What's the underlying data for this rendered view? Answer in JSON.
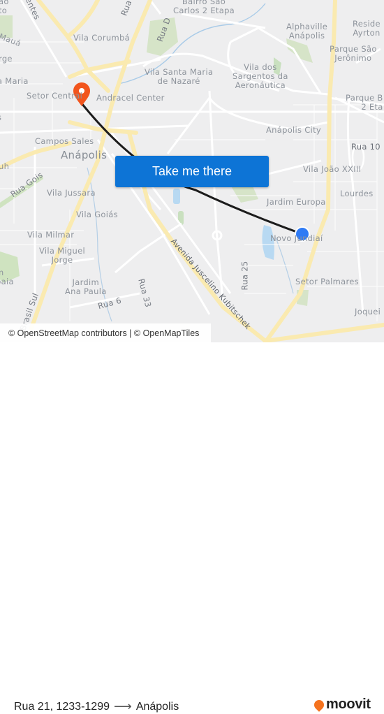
{
  "map": {
    "labels": [
      {
        "text": "Bairro São\nCarlos 2 Etapa",
        "name": "label-bairro-sao-carlos"
      },
      {
        "text": "Alphaville\nAnápolis",
        "name": "label-alphaville"
      },
      {
        "text": "Reside\nAyrton",
        "name": "label-residencial-ayrton"
      },
      {
        "text": "Parque São\nJerônimo",
        "name": "label-parque-sao-jeronimo"
      },
      {
        "text": "Vila Corumbá",
        "name": "label-vila-corumba"
      },
      {
        "text": "Vila Santa Maria\nde Nazaré",
        "name": "label-vila-santa-maria-nazare"
      },
      {
        "text": "Vila dos\nSargentos da\nAeronáutica",
        "name": "label-vila-sargentos"
      },
      {
        "text": "Setor Central",
        "name": "label-setor-central"
      },
      {
        "text": "Andracel Center",
        "name": "label-andracel-center"
      },
      {
        "text": "Parque B\n2 Eta",
        "name": "label-parque-b"
      },
      {
        "text": "Anápolis City",
        "name": "label-anapolis-city"
      },
      {
        "text": "Campos Sales",
        "name": "label-campos-sales"
      },
      {
        "text": "Anápolis",
        "name": "label-anapolis"
      },
      {
        "text": "Rua 10",
        "name": "label-rua-10"
      },
      {
        "text": "Vila João XXIII",
        "name": "label-vila-joao-xxiii"
      },
      {
        "text": "Lourdes",
        "name": "label-lourdes"
      },
      {
        "text": "Jardim Europa",
        "name": "label-jardim-europa"
      },
      {
        "text": "Vila Jussara",
        "name": "label-vila-jussara"
      },
      {
        "text": "Vila Goiás",
        "name": "label-vila-goias"
      },
      {
        "text": "Vila Milmar",
        "name": "label-vila-milmar"
      },
      {
        "text": "Vila Miguel\nJorge",
        "name": "label-vila-miguel-jorge"
      },
      {
        "text": "Novo Jundiaí",
        "name": "label-novo-jundiai"
      },
      {
        "text": "Jardim\nAna Paula",
        "name": "label-jardim-ana-paula"
      },
      {
        "text": "Setor Palmares",
        "name": "label-setor-palmares"
      },
      {
        "text": "Joquei",
        "name": "label-joquei"
      },
      {
        "text": "a Maria",
        "name": "label-a-maria"
      },
      {
        "text": "Mauá",
        "name": "label-maua"
      },
      {
        "text": "rge",
        "name": "label-rge"
      },
      {
        "text": "ão\nto",
        "name": "label-ao-to"
      },
      {
        "text": "m\nbaia",
        "name": "label-m-baia"
      },
      {
        "text": "uh",
        "name": "label-uh"
      },
      {
        "text": "s",
        "name": "label-s"
      }
    ],
    "streets": [
      {
        "text": "Rua D",
        "name": "street-rua-d"
      },
      {
        "text": "Rua",
        "name": "street-rua-top"
      },
      {
        "text": "entes",
        "name": "street-entes"
      },
      {
        "text": "Rua Gois",
        "name": "street-rua-gois"
      },
      {
        "text": "Avenida Juscelino Kubitschek",
        "name": "street-av-jk"
      },
      {
        "text": "Rua 25",
        "name": "street-rua-25"
      },
      {
        "text": "Rua 33",
        "name": "street-rua-33"
      },
      {
        "text": "Rua 6",
        "name": "street-rua-6"
      },
      {
        "text": "Brasil Sul",
        "name": "street-brasil-sul"
      }
    ],
    "origin_color": "#2f7bf5",
    "destination_color": "#f2551d",
    "route_color": "#1c1c1c"
  },
  "cta": {
    "label": "Take me there"
  },
  "attribution": "© OpenStreetMap contributors | © OpenMapTiles",
  "footer": {
    "origin": "Rua 21, 1233-1299",
    "arrow": "⟶",
    "destination": "Anápolis",
    "brand": "moovit"
  }
}
